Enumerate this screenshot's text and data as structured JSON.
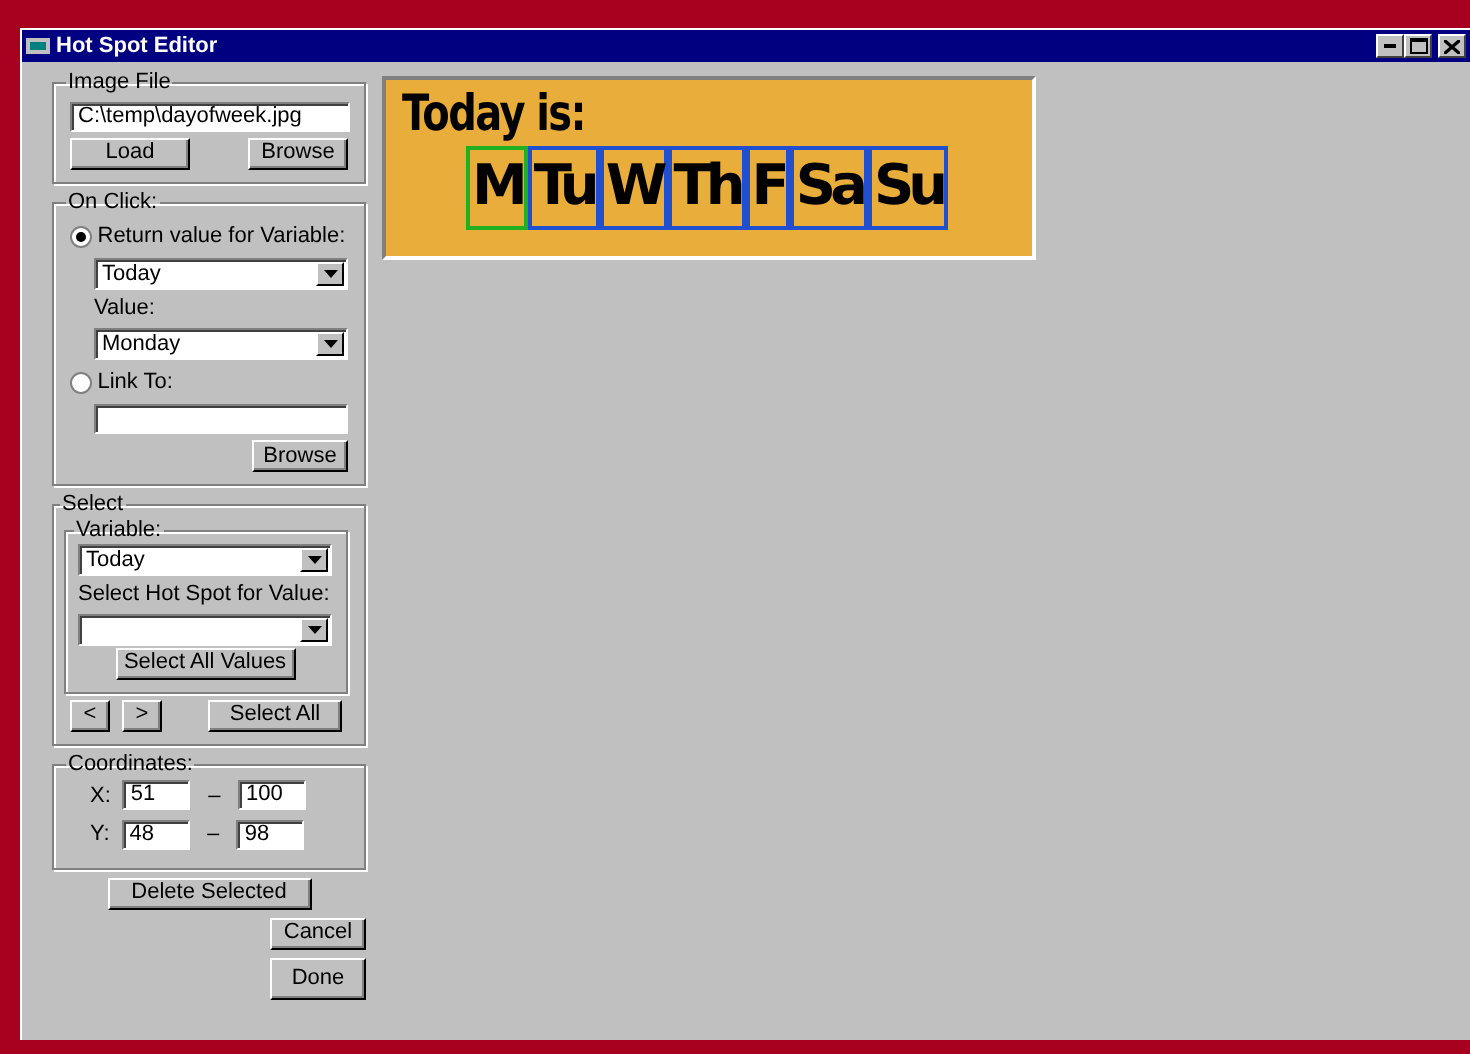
{
  "window": {
    "title": "Hot Spot Editor"
  },
  "image_file": {
    "label": "Image File",
    "value": "C:\\temp\\dayofweek.jpg",
    "load_button": "Load",
    "browse_button": "Browse"
  },
  "on_click": {
    "label": "On Click:",
    "return_option": {
      "label": "Return value for Variable:",
      "selected": true
    },
    "variable": "Today",
    "value_label": "Value:",
    "value": "Monday",
    "link_option": {
      "label": "Link To:",
      "selected": false
    },
    "browse_button": "Browse"
  },
  "select": {
    "label": "Select",
    "variable_label": "Variable:",
    "variable": "Today",
    "hot_spot_label": "Select Hot Spot for Value:",
    "select_all_values_button": "Select All Values",
    "prev_button": "<",
    "next_button": ">",
    "select_all_button": "Select All"
  },
  "coordinates": {
    "label": "Coordinates:",
    "rows": [
      {
        "axis": "X:",
        "from": "51",
        "dash": "–",
        "to": "100"
      },
      {
        "axis": "Y:",
        "from": "48",
        "dash": "–",
        "to": "98"
      }
    ]
  },
  "delete_button": "Delete Selected",
  "cancel_button": "Cancel",
  "done_button": "Done",
  "image": {
    "title": "Today is:",
    "hot_spots": [
      {
        "label": "M",
        "selected": true
      },
      {
        "label": "Tu",
        "selected": false
      },
      {
        "label": "W",
        "selected": false
      },
      {
        "label": "Th",
        "selected": false
      },
      {
        "label": "F",
        "selected": false
      },
      {
        "label": "Sa",
        "selected": false
      },
      {
        "label": "Su",
        "selected": false
      }
    ]
  }
}
